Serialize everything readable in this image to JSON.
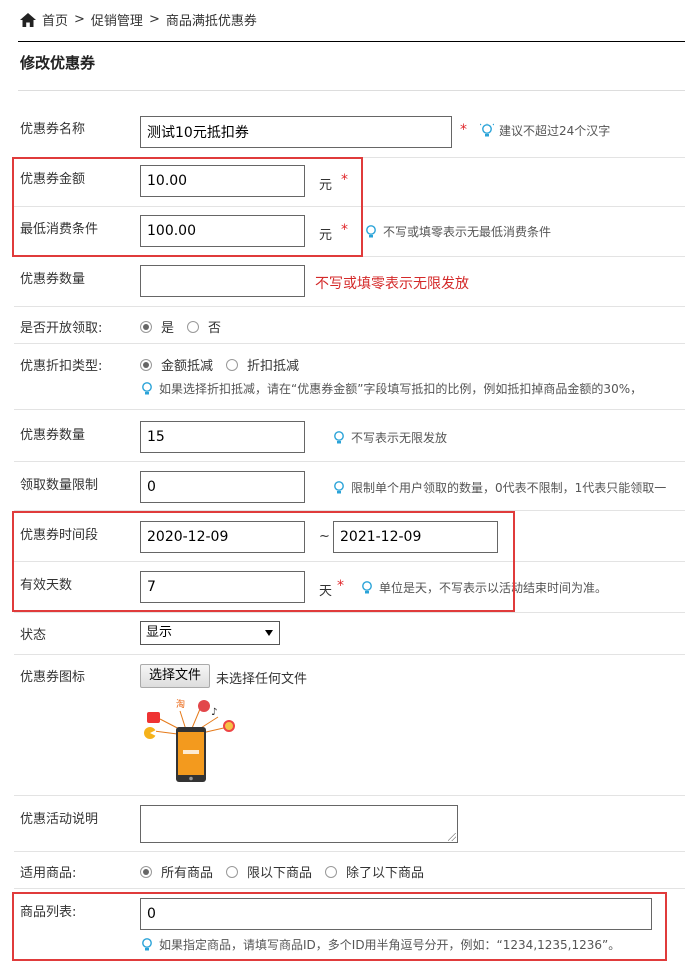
{
  "breadcrumb": {
    "home": "首页",
    "sep1": ">",
    "section": "促销管理",
    "sep2": ">",
    "current": "商品满抵优惠券"
  },
  "page_title": "修改优惠券",
  "form": {
    "name": {
      "label": "优惠券名称",
      "value": "测试10元抵扣券",
      "required": "*",
      "tip": "建议不超过24个汉字"
    },
    "amount": {
      "label": "优惠券金额",
      "value": "10.00",
      "unit": "元",
      "required": "*"
    },
    "min_spend": {
      "label": "最低消费条件",
      "value": "100.00",
      "unit": "元",
      "required": "*",
      "tip": "不写或填零表示无最低消费条件"
    },
    "quantity1": {
      "label": "优惠券数量",
      "value": "",
      "note": "不写或填零表示无限发放"
    },
    "open_claim": {
      "label": "是否开放领取:",
      "options": [
        "是",
        "否"
      ],
      "selected": "是"
    },
    "discount_type": {
      "label": "优惠折扣类型:",
      "options": [
        "金额抵减",
        "折扣抵减"
      ],
      "selected": "金额抵减",
      "tip": "如果选择折扣抵减，请在“优惠券金额”字段填写抵扣的比例，例如抵扣掉商品金额的30%，"
    },
    "quantity2": {
      "label": "优惠券数量",
      "value": "15",
      "tip": "不写表示无限发放"
    },
    "claim_limit": {
      "label": "领取数量限制",
      "value": "0",
      "tip": "限制单个用户领取的数量，0代表不限制，1代表只能领取一"
    },
    "period": {
      "label": "优惠券时间段",
      "start": "2020-12-09",
      "tilde": "~",
      "end": "2021-12-09"
    },
    "valid_days": {
      "label": "有效天数",
      "value": "7",
      "unit": "天",
      "required": "*",
      "tip": "单位是天，不写表示以活动结束时间为准。"
    },
    "status": {
      "label": "状态",
      "selected": "显示"
    },
    "icon": {
      "label": "优惠券图标",
      "button": "选择文件",
      "file_status": "未选择任何文件"
    },
    "description": {
      "label": "优惠活动说明",
      "value": ""
    },
    "applicable": {
      "label": "适用商品:",
      "options": [
        "所有商品",
        "限以下商品",
        "除了以下商品"
      ],
      "selected": "所有商品"
    },
    "product_list": {
      "label": "商品列表:",
      "value": "0",
      "tip": "如果指定商品，请填写商品ID，多个ID用半角逗号分开，例如：“1234,1235,1236”。"
    }
  },
  "colors": {
    "highlight_box": "#e03b3b",
    "required": "#e0262a",
    "tip_icon": "#2aa3d8",
    "phone_orange": "#f39a1e"
  }
}
